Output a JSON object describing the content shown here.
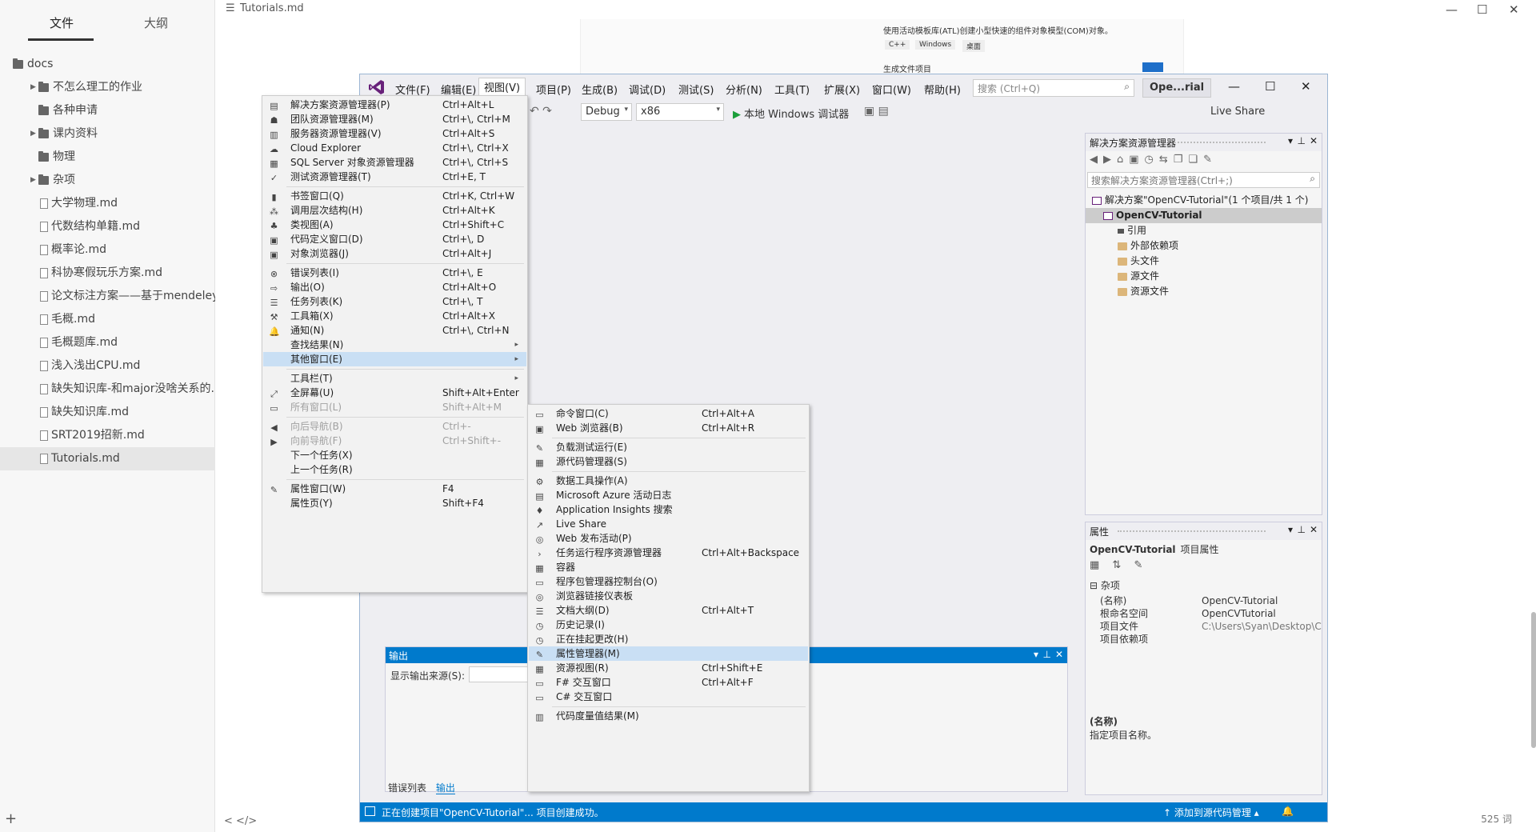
{
  "typora": {
    "tabs": {
      "files": "文件",
      "outline": "大纲"
    },
    "tree": [
      {
        "label": "docs",
        "type": "folder",
        "depth": 0,
        "caret": ""
      },
      {
        "label": "不怎么理工的作业",
        "type": "folder",
        "depth": 1,
        "caret": "▶"
      },
      {
        "label": "各种申请",
        "type": "folder",
        "depth": 1,
        "caret": ""
      },
      {
        "label": "课内资料",
        "type": "folder",
        "depth": 1,
        "caret": "▶"
      },
      {
        "label": "物理",
        "type": "folder",
        "depth": 1,
        "caret": ""
      },
      {
        "label": "杂项",
        "type": "folder",
        "depth": 1,
        "caret": "▶"
      },
      {
        "label": "大学物理.md",
        "type": "file",
        "depth": 1,
        "caret": ""
      },
      {
        "label": "代数结构单籍.md",
        "type": "file",
        "depth": 1,
        "caret": ""
      },
      {
        "label": "概率论.md",
        "type": "file",
        "depth": 1,
        "caret": ""
      },
      {
        "label": "科协寒假玩乐方案.md",
        "type": "file",
        "depth": 1,
        "caret": ""
      },
      {
        "label": "论文标注方案——基于mendeley.md",
        "type": "file",
        "depth": 1,
        "caret": ""
      },
      {
        "label": "毛概.md",
        "type": "file",
        "depth": 1,
        "caret": ""
      },
      {
        "label": "毛概题库.md",
        "type": "file",
        "depth": 1,
        "caret": ""
      },
      {
        "label": "浅入浅出CPU.md",
        "type": "file",
        "depth": 1,
        "caret": ""
      },
      {
        "label": "缺失知识库-和major没啥关系的.md",
        "type": "file",
        "depth": 1,
        "caret": ""
      },
      {
        "label": "缺失知识库.md",
        "type": "file",
        "depth": 1,
        "caret": ""
      },
      {
        "label": "SRT2019招新.md",
        "type": "file",
        "depth": 1,
        "caret": ""
      },
      {
        "label": "Tutorials.md",
        "type": "file",
        "depth": 1,
        "caret": "",
        "active": true
      }
    ],
    "add_glyph": "+",
    "title": "Tutorials.md",
    "menu_glyph": "☰",
    "nav_glyphs": "<  </>",
    "word_count": "525 词",
    "win": {
      "min": "—",
      "max": "☐",
      "close": "✕"
    },
    "snippet": {
      "line1": "使用活动模板库(ATL)创建小型快速的组件对象模型(COM)对象。",
      "tags": [
        "C++",
        "Windows",
        "桌面"
      ],
      "line2": "生成文件项目"
    }
  },
  "vs": {
    "menus": [
      "文件(F)",
      "编辑(E)",
      "视图(V)",
      "项目(P)",
      "生成(B)",
      "调试(D)",
      "测试(S)",
      "分析(N)",
      "工具(T)",
      "扩展(X)",
      "窗口(W)",
      "帮助(H)"
    ],
    "search_placeholder": "搜索 (Ctrl+Q)",
    "search_glyph": "⌕",
    "project_short": "Ope...rial",
    "win": {
      "min": "—",
      "max": "☐",
      "close": "✕"
    },
    "toolbar": {
      "config": "Debug",
      "platform": "x86",
      "run_label": "本地 Windows 调试器",
      "play_glyph": "▶",
      "live_share": "Live Share",
      "combo_arrow": "▾",
      "undo_glyphs": "↶ ↷",
      "extra_glyphs": "▣ ▤"
    },
    "solution_explorer": {
      "title": "解决方案资源管理器",
      "tool_glyphs": "◀▶⌂▣◷⇆❐❏✎",
      "search_placeholder": "搜索解决方案资源管理器(Ctrl+;)",
      "search_glyph": "⌕",
      "pane_buttons": {
        "dropdown": "▾",
        "pin": "⊥",
        "close": "✕"
      },
      "items": [
        {
          "label": "解决方案\"OpenCV-Tutorial\"(1 个项目/共 1 个)",
          "indent": 8,
          "icon": "sol"
        },
        {
          "label": "OpenCV-Tutorial",
          "indent": 22,
          "icon": "sol",
          "selected": true
        },
        {
          "label": "引用",
          "indent": 40,
          "icon": "ref"
        },
        {
          "label": "外部依赖项",
          "indent": 40,
          "icon": "folder"
        },
        {
          "label": "头文件",
          "indent": 40,
          "icon": "folder"
        },
        {
          "label": "源文件",
          "indent": 40,
          "icon": "folder"
        },
        {
          "label": "资源文件",
          "indent": 40,
          "icon": "folder"
        }
      ]
    },
    "properties": {
      "title": "属性",
      "header_name": "OpenCV-Tutorial",
      "header_type": "项目属性",
      "tool_glyphs": "▦ ⇅ ✎",
      "category": "杂项",
      "rows": [
        {
          "key": "(名称)",
          "value": "OpenCV-Tutorial",
          "dim": false
        },
        {
          "key": "根命名空间",
          "value": "OpenCVTutorial",
          "dim": false
        },
        {
          "key": "项目文件",
          "value": "C:\\Users\\Syan\\Desktop\\C",
          "dim": true
        },
        {
          "key": "项目依赖项",
          "value": "",
          "dim": false
        }
      ],
      "desc_key": "(名称)",
      "desc_value": "指定项目名称。"
    },
    "output": {
      "title": "输出",
      "source_label": "显示输出来源(S):"
    },
    "bottom_tabs": [
      "错误列表",
      "输出"
    ],
    "status": {
      "message": "正在创建项目\"OpenCV-Tutorial\"... 项目创建成功。",
      "source_control": "↑ 添加到源代码管理 ▴",
      "bell": "🔔"
    }
  },
  "view_menu": [
    {
      "label": "解决方案资源管理器(P)",
      "shortcut": "Ctrl+Alt+L",
      "icon": "▤"
    },
    {
      "label": "团队资源管理器(M)",
      "shortcut": "Ctrl+\\, Ctrl+M",
      "icon": "☗"
    },
    {
      "label": "服务器资源管理器(V)",
      "shortcut": "Ctrl+Alt+S",
      "icon": "▥"
    },
    {
      "label": "Cloud Explorer",
      "shortcut": "Ctrl+\\, Ctrl+X",
      "icon": "☁"
    },
    {
      "label": "SQL Server 对象资源管理器",
      "shortcut": "Ctrl+\\, Ctrl+S",
      "icon": "▦"
    },
    {
      "label": "测试资源管理器(T)",
      "shortcut": "Ctrl+E, T",
      "icon": "✓"
    },
    {
      "sep": true
    },
    {
      "label": "书签窗口(Q)",
      "shortcut": "Ctrl+K, Ctrl+W",
      "icon": "▮"
    },
    {
      "label": "调用层次结构(H)",
      "shortcut": "Ctrl+Alt+K",
      "icon": "⁂"
    },
    {
      "label": "类视图(A)",
      "shortcut": "Ctrl+Shift+C",
      "icon": "♣"
    },
    {
      "label": "代码定义窗口(D)",
      "shortcut": "Ctrl+\\, D",
      "icon": "▣"
    },
    {
      "label": "对象浏览器(J)",
      "shortcut": "Ctrl+Alt+J",
      "icon": "▣"
    },
    {
      "sep": true
    },
    {
      "label": "错误列表(I)",
      "shortcut": "Ctrl+\\, E",
      "icon": "⊗"
    },
    {
      "label": "输出(O)",
      "shortcut": "Ctrl+Alt+O",
      "icon": "⇨"
    },
    {
      "label": "任务列表(K)",
      "shortcut": "Ctrl+\\, T",
      "icon": "☰"
    },
    {
      "label": "工具箱(X)",
      "shortcut": "Ctrl+Alt+X",
      "icon": "⚒"
    },
    {
      "label": "通知(N)",
      "shortcut": "Ctrl+\\, Ctrl+N",
      "icon": "🔔"
    },
    {
      "label": "查找结果(N)",
      "shortcut": "",
      "icon": "",
      "submenu": true
    },
    {
      "label": "其他窗口(E)",
      "shortcut": "",
      "icon": "",
      "submenu": true,
      "highlight": true
    },
    {
      "sep": true
    },
    {
      "label": "工具栏(T)",
      "shortcut": "",
      "icon": "",
      "submenu": true
    },
    {
      "label": "全屏幕(U)",
      "shortcut": "Shift+Alt+Enter",
      "icon": "⤢"
    },
    {
      "label": "所有窗口(L)",
      "shortcut": "Shift+Alt+M",
      "icon": "▭",
      "disabled": true
    },
    {
      "sep": true
    },
    {
      "label": "向后导航(B)",
      "shortcut": "Ctrl+-",
      "icon": "◀",
      "disabled": true
    },
    {
      "label": "向前导航(F)",
      "shortcut": "Ctrl+Shift+-",
      "icon": "▶",
      "disabled": true
    },
    {
      "label": "下一个任务(X)",
      "shortcut": "",
      "icon": ""
    },
    {
      "label": "上一个任务(R)",
      "shortcut": "",
      "icon": ""
    },
    {
      "sep": true
    },
    {
      "label": "属性窗口(W)",
      "shortcut": "F4",
      "icon": "✎"
    },
    {
      "label": "属性页(Y)",
      "shortcut": "Shift+F4",
      "icon": ""
    }
  ],
  "other_windows_menu": [
    {
      "label": "命令窗口(C)",
      "shortcut": "Ctrl+Alt+A",
      "icon": "▭"
    },
    {
      "label": "Web 浏览器(B)",
      "shortcut": "Ctrl+Alt+R",
      "icon": "▣"
    },
    {
      "sep": true
    },
    {
      "label": "负载测试运行(E)",
      "shortcut": "",
      "icon": "✎"
    },
    {
      "label": "源代码管理器(S)",
      "shortcut": "",
      "icon": "▦"
    },
    {
      "sep": true
    },
    {
      "label": "数据工具操作(A)",
      "shortcut": "",
      "icon": "⚙"
    },
    {
      "label": "Microsoft Azure 活动日志",
      "shortcut": "",
      "icon": "▤"
    },
    {
      "label": "Application Insights 搜索",
      "shortcut": "",
      "icon": "♦"
    },
    {
      "label": "Live Share",
      "shortcut": "",
      "icon": "↗"
    },
    {
      "label": "Web 发布活动(P)",
      "shortcut": "",
      "icon": "◎"
    },
    {
      "label": "任务运行程序资源管理器",
      "shortcut": "Ctrl+Alt+Backspace",
      "icon": "›"
    },
    {
      "label": "容器",
      "shortcut": "",
      "icon": "▦"
    },
    {
      "label": "程序包管理器控制台(O)",
      "shortcut": "",
      "icon": "▭"
    },
    {
      "label": "浏览器链接仪表板",
      "shortcut": "",
      "icon": "◎"
    },
    {
      "label": "文档大纲(D)",
      "shortcut": "Ctrl+Alt+T",
      "icon": "☰"
    },
    {
      "label": "历史记录(I)",
      "shortcut": "",
      "icon": "◷"
    },
    {
      "label": "正在挂起更改(H)",
      "shortcut": "",
      "icon": "◷"
    },
    {
      "label": "属性管理器(M)",
      "shortcut": "",
      "icon": "✎",
      "highlight": true
    },
    {
      "label": "资源视图(R)",
      "shortcut": "Ctrl+Shift+E",
      "icon": "▦"
    },
    {
      "label": "F# 交互窗口",
      "shortcut": "Ctrl+Alt+F",
      "icon": "▭"
    },
    {
      "label": "C# 交互窗口",
      "shortcut": "",
      "icon": "▭"
    },
    {
      "sep": true
    },
    {
      "label": "代码度量值结果(M)",
      "shortcut": "",
      "icon": "▥"
    }
  ]
}
